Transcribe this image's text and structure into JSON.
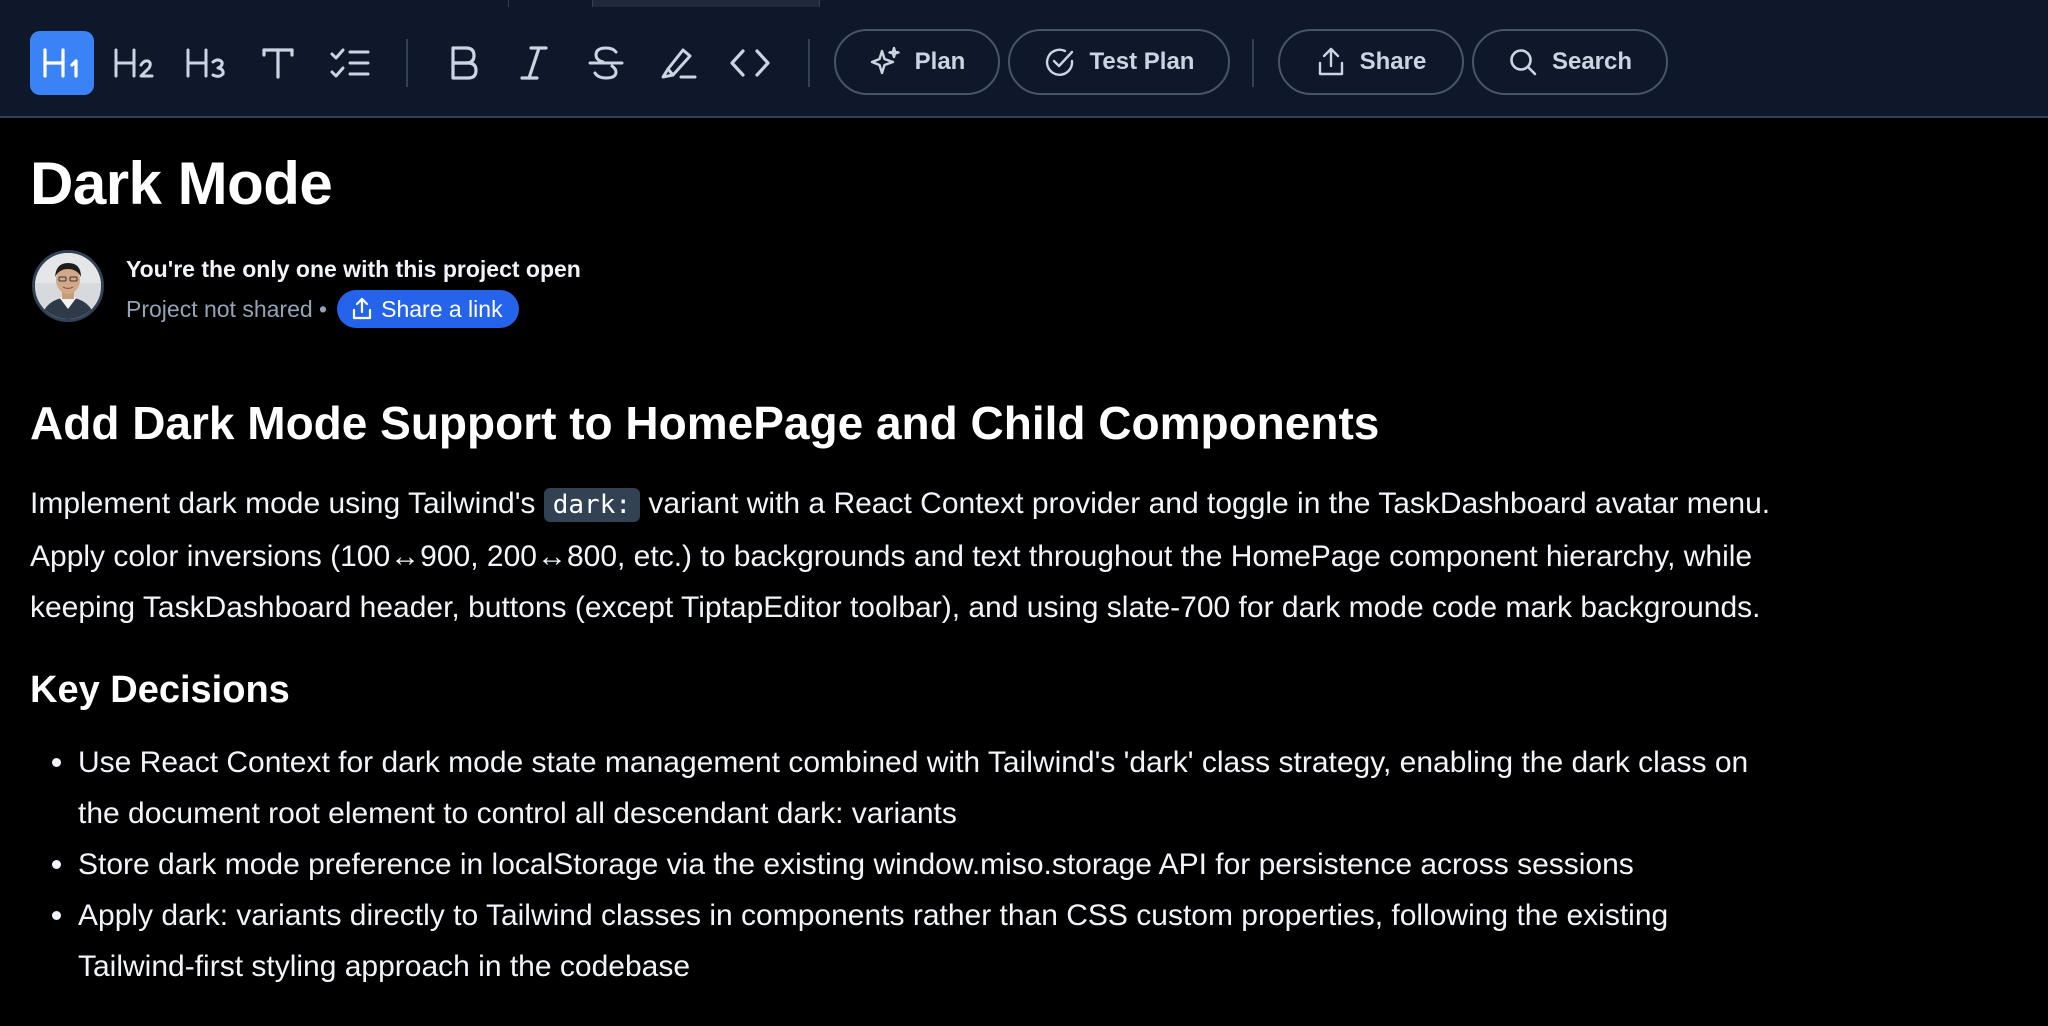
{
  "toolbar": {
    "format_buttons": [
      {
        "name": "heading-1",
        "label": "H1"
      },
      {
        "name": "heading-2",
        "label": "H2"
      },
      {
        "name": "heading-3",
        "label": "H3"
      },
      {
        "name": "text",
        "label": "T"
      },
      {
        "name": "task-list",
        "label": ""
      },
      {
        "name": "bold",
        "label": "B"
      },
      {
        "name": "italic",
        "label": "I"
      },
      {
        "name": "strikethrough",
        "label": "S"
      },
      {
        "name": "highlight",
        "label": ""
      },
      {
        "name": "code",
        "label": ""
      }
    ],
    "active_button": "heading-1",
    "plan_label": "Plan",
    "test_plan_label": "Test Plan",
    "share_label": "Share",
    "search_label": "Search"
  },
  "document": {
    "title": "Dark Mode",
    "collaboration": {
      "status": "You're the only one with this project open",
      "sharing_status": "Project not shared •",
      "share_link_label": "Share a link"
    },
    "heading": "Add Dark Mode Support to HomePage and Child Components",
    "paragraph": {
      "line1_before": "Implement dark mode using Tailwind's ",
      "code": "dark:",
      "line1_after": " variant with a React Context provider and toggle in the TaskDashboard avatar menu.",
      "line2": "Apply color inversions (100↔900, 200↔800, etc.) to backgrounds and text throughout the HomePage component hierarchy, while",
      "line3": "keeping TaskDashboard header, buttons (except TiptapEditor toolbar), and using slate-700 for dark mode code mark backgrounds."
    },
    "key_decisions": {
      "heading": "Key Decisions",
      "items": [
        {
          "line1": "Use React Context for dark mode state management combined with Tailwind's 'dark' class strategy, enabling the dark class on",
          "line2": "the document root element to control all descendant dark: variants"
        },
        {
          "line1": "Store dark mode preference in localStorage via the existing window.miso.storage API for persistence across sessions"
        },
        {
          "line1": "Apply dark: variants directly to Tailwind classes in components rather than CSS custom properties, following the existing",
          "line2": "Tailwind-first styling approach in the codebase"
        }
      ]
    }
  },
  "colors": {
    "background": "#000000",
    "toolbar_bg": "#0f172a",
    "accent": "#3b82f6",
    "link_button": "#2563eb",
    "code_bg": "#334155"
  }
}
